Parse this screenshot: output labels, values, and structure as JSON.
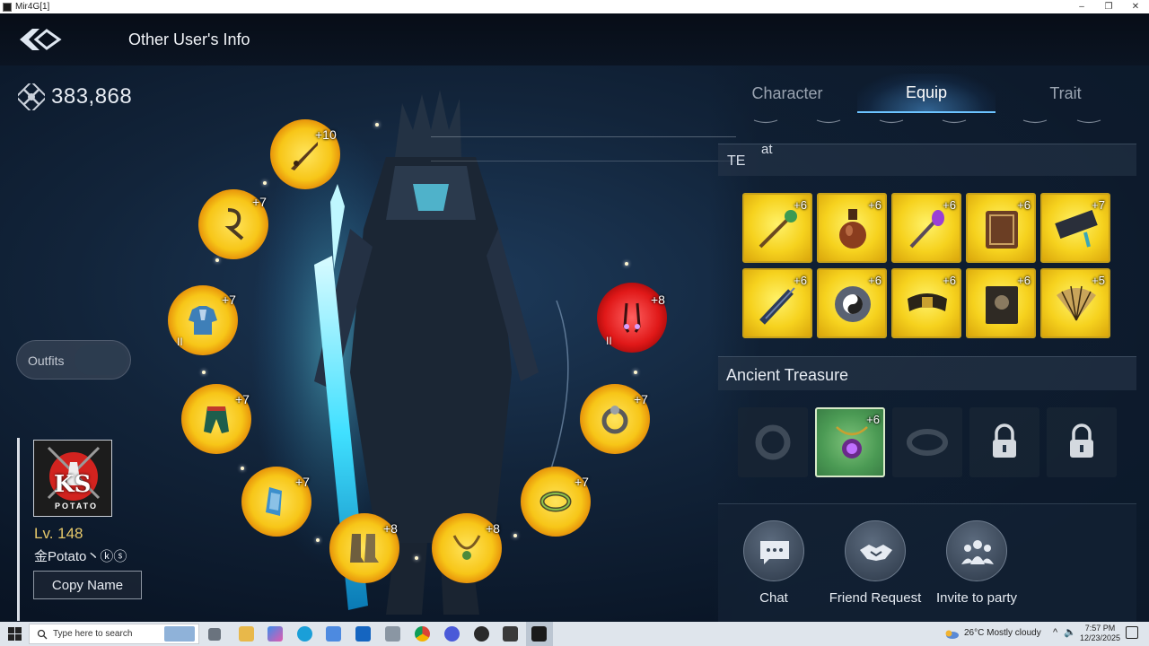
{
  "window": {
    "title": "Mir4G[1]",
    "controls": [
      "–",
      "❐",
      "✕"
    ]
  },
  "header": {
    "title": "Other User's Info",
    "back_icon": "back-arrow-icon"
  },
  "power": {
    "value": "383,868",
    "icon": "combat-power-icon"
  },
  "outfits": {
    "label": "Outfits"
  },
  "profile": {
    "level": "Lv. 148",
    "name": "金Potato丶ⓚⓢ",
    "copy_label": "Copy Name",
    "avatar_text": "KS",
    "avatar_sub": "POTATO"
  },
  "character_slots": [
    {
      "item": "weapon",
      "enhance": "+10",
      "state": "gold",
      "tier": ""
    },
    {
      "item": "hook",
      "enhance": "+7",
      "state": "gold",
      "tier": ""
    },
    {
      "item": "armor",
      "enhance": "+7",
      "state": "gold",
      "tier": "II"
    },
    {
      "item": "skirt",
      "enhance": "+7",
      "state": "gold",
      "tier": ""
    },
    {
      "item": "bracer",
      "enhance": "+7",
      "state": "gold",
      "tier": ""
    },
    {
      "item": "boots",
      "enhance": "+8",
      "state": "gold",
      "tier": ""
    },
    {
      "item": "necklace",
      "enhance": "+8",
      "state": "gold",
      "tier": ""
    },
    {
      "item": "bracelet",
      "enhance": "+7",
      "state": "gold",
      "tier": ""
    },
    {
      "item": "ring",
      "enhance": "+7",
      "state": "gold",
      "tier": ""
    },
    {
      "item": "earrings",
      "enhance": "+8",
      "state": "red",
      "tier": "II"
    }
  ],
  "tabs": [
    {
      "label": "Character",
      "active": false
    },
    {
      "label": "Equip",
      "active": true
    },
    {
      "label": "Trait",
      "active": false
    }
  ],
  "te_section": {
    "label": "TE",
    "overlay": "at"
  },
  "equip_grid": [
    {
      "item": "staff",
      "enhance": "+6"
    },
    {
      "item": "potion",
      "enhance": "+6"
    },
    {
      "item": "scepter",
      "enhance": "+6"
    },
    {
      "item": "tome",
      "enhance": "+6"
    },
    {
      "item": "case",
      "enhance": "+7"
    },
    {
      "item": "mace",
      "enhance": "+6"
    },
    {
      "item": "yin-yang",
      "enhance": "+6"
    },
    {
      "item": "belt",
      "enhance": "+6"
    },
    {
      "item": "book",
      "enhance": "+6"
    },
    {
      "item": "fan",
      "enhance": "+5"
    }
  ],
  "ancient_treasure": {
    "label": "Ancient Treasure",
    "slots": [
      {
        "item": "ring-empty",
        "enhance": "",
        "state": "empty"
      },
      {
        "item": "amulet",
        "enhance": "+6",
        "state": "active"
      },
      {
        "item": "bracelet-empty",
        "enhance": "",
        "state": "empty"
      },
      {
        "item": "lock",
        "enhance": "",
        "state": "locked"
      },
      {
        "item": "lock",
        "enhance": "",
        "state": "locked"
      }
    ]
  },
  "social": [
    {
      "label": "Chat",
      "icon": "chat-icon"
    },
    {
      "label": "Friend Request",
      "icon": "handshake-icon"
    },
    {
      "label": "Invite to party",
      "icon": "party-icon"
    }
  ],
  "taskbar": {
    "search_placeholder": "Type here to search",
    "weather": "26°C  Mostly cloudy",
    "time": "7:57 PM",
    "date": "12/23/2025"
  },
  "colors": {
    "gold": "#f6d21e",
    "red": "#e01818",
    "accent": "#6cc3ff",
    "level": "#e6c86a"
  }
}
